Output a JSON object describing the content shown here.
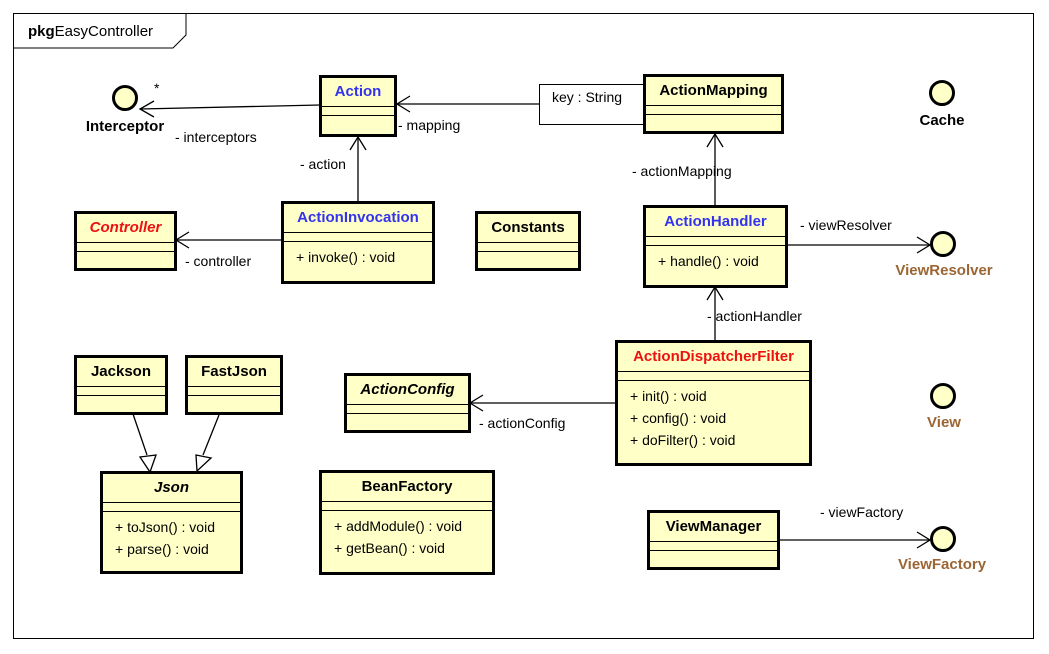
{
  "package": {
    "keyword": "pkg",
    "name": "EasyController"
  },
  "classes": {
    "action": {
      "name": "Action",
      "operations": []
    },
    "action_mapping": {
      "name": "ActionMapping",
      "operations": []
    },
    "controller": {
      "name": "Controller",
      "operations": []
    },
    "action_invocation": {
      "name": "ActionInvocation",
      "operations": [
        "+ invoke() : void"
      ]
    },
    "constants": {
      "name": "Constants",
      "operations": []
    },
    "action_handler": {
      "name": "ActionHandler",
      "operations": [
        "+ handle() : void"
      ]
    },
    "action_dispatcher_filter": {
      "name": "ActionDispatcherFilter",
      "operations": [
        "+ init() : void",
        "+ config() : void",
        "+ doFilter() : void"
      ]
    },
    "action_config": {
      "name": "ActionConfig",
      "operations": []
    },
    "jackson": {
      "name": "Jackson",
      "operations": []
    },
    "fastjson": {
      "name": "FastJson",
      "operations": []
    },
    "json": {
      "name": "Json",
      "operations": [
        "+ toJson() : void",
        "+ parse() : void"
      ]
    },
    "bean_factory": {
      "name": "BeanFactory",
      "operations": [
        "+ addModule() : void",
        "+ getBean() : void"
      ]
    },
    "view_manager": {
      "name": "ViewManager",
      "operations": []
    }
  },
  "interfaces": {
    "interceptor": "Interceptor",
    "cache": "Cache",
    "view_resolver": "ViewResolver",
    "view": "View",
    "view_factory": "ViewFactory"
  },
  "associations": {
    "interceptors": "- interceptors",
    "interceptors_multiplicity": "*",
    "mapping": "- mapping",
    "qualifier": "key : String",
    "action": "- action",
    "controller": "- controller",
    "action_mapping": "- actionMapping",
    "view_resolver": "- viewResolver",
    "action_handler": "- actionHandler",
    "action_config": "- actionConfig",
    "view_factory": "- viewFactory"
  }
}
